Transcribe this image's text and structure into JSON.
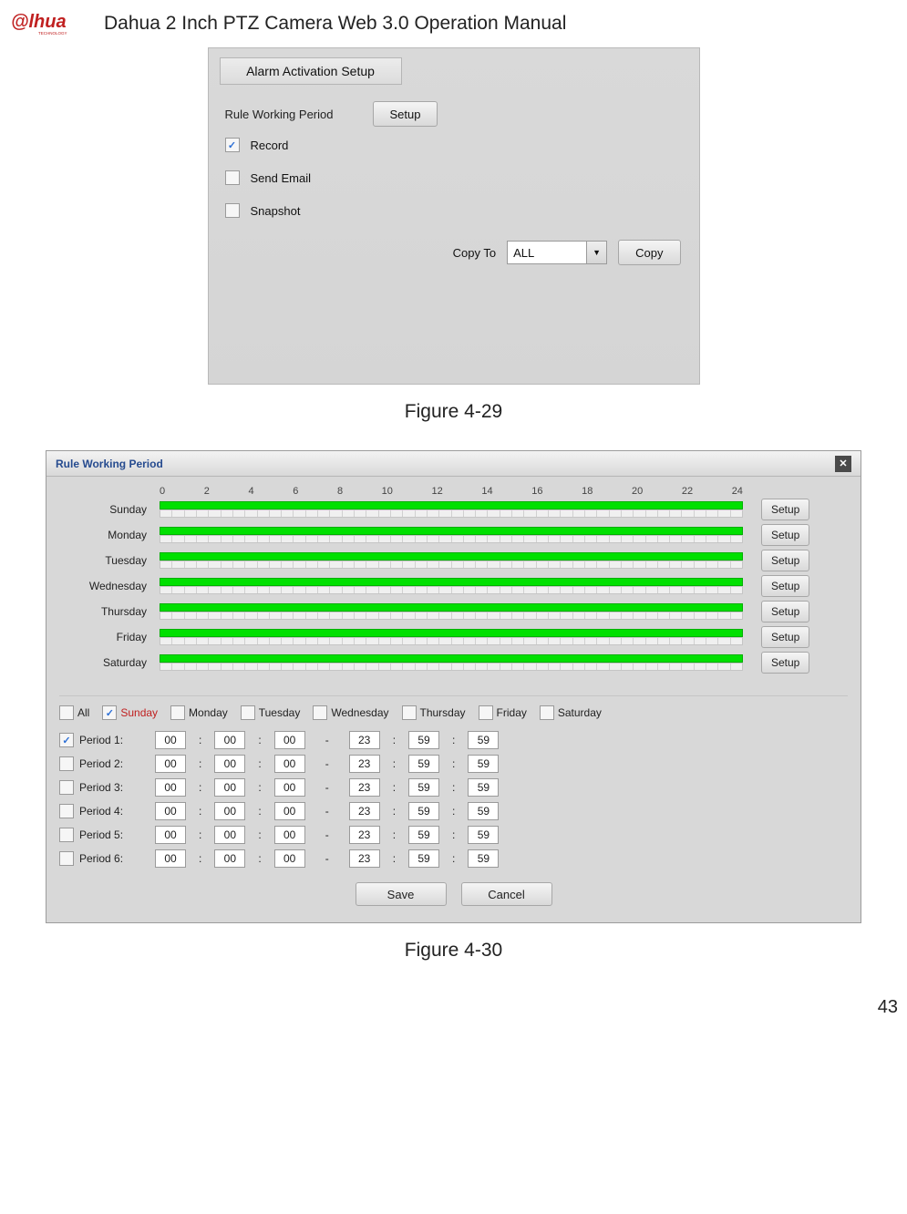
{
  "header": {
    "title": "Dahua 2 Inch PTZ Camera Web 3.0 Operation Manual",
    "logo_text": "alhua",
    "logo_sub": "TECHNOLOGY"
  },
  "figure29": {
    "caption": "Figure 4-29",
    "panel_tab": "Alarm Activation Setup",
    "rule_label": "Rule Working Period",
    "setup_btn": "Setup",
    "record": "Record",
    "send_email": "Send Email",
    "snapshot": "Snapshot",
    "copy_to": "Copy To",
    "copy_sel": "ALL",
    "copy_btn": "Copy"
  },
  "figure30": {
    "caption": "Figure 4-30",
    "title": "Rule Working Period",
    "ticks": [
      "0",
      "2",
      "4",
      "6",
      "8",
      "10",
      "12",
      "14",
      "16",
      "18",
      "20",
      "22",
      "24"
    ],
    "days": [
      "Sunday",
      "Monday",
      "Tuesday",
      "Wednesday",
      "Thursday",
      "Friday",
      "Saturday"
    ],
    "setup_btn": "Setup",
    "day_checks": {
      "all": "All",
      "sunday": "Sunday",
      "monday": "Monday",
      "tuesday": "Tuesday",
      "wednesday": "Wednesday",
      "thursday": "Thursday",
      "friday": "Friday",
      "saturday": "Saturday"
    },
    "periods": [
      {
        "label": "Period 1:",
        "checked": true,
        "s": [
          "00",
          "00",
          "00"
        ],
        "e": [
          "23",
          "59",
          "59"
        ]
      },
      {
        "label": "Period 2:",
        "checked": false,
        "s": [
          "00",
          "00",
          "00"
        ],
        "e": [
          "23",
          "59",
          "59"
        ]
      },
      {
        "label": "Period 3:",
        "checked": false,
        "s": [
          "00",
          "00",
          "00"
        ],
        "e": [
          "23",
          "59",
          "59"
        ]
      },
      {
        "label": "Period 4:",
        "checked": false,
        "s": [
          "00",
          "00",
          "00"
        ],
        "e": [
          "23",
          "59",
          "59"
        ]
      },
      {
        "label": "Period 5:",
        "checked": false,
        "s": [
          "00",
          "00",
          "00"
        ],
        "e": [
          "23",
          "59",
          "59"
        ]
      },
      {
        "label": "Period 6:",
        "checked": false,
        "s": [
          "00",
          "00",
          "00"
        ],
        "e": [
          "23",
          "59",
          "59"
        ]
      }
    ],
    "save_btn": "Save",
    "cancel_btn": "Cancel"
  },
  "page_number": "43"
}
